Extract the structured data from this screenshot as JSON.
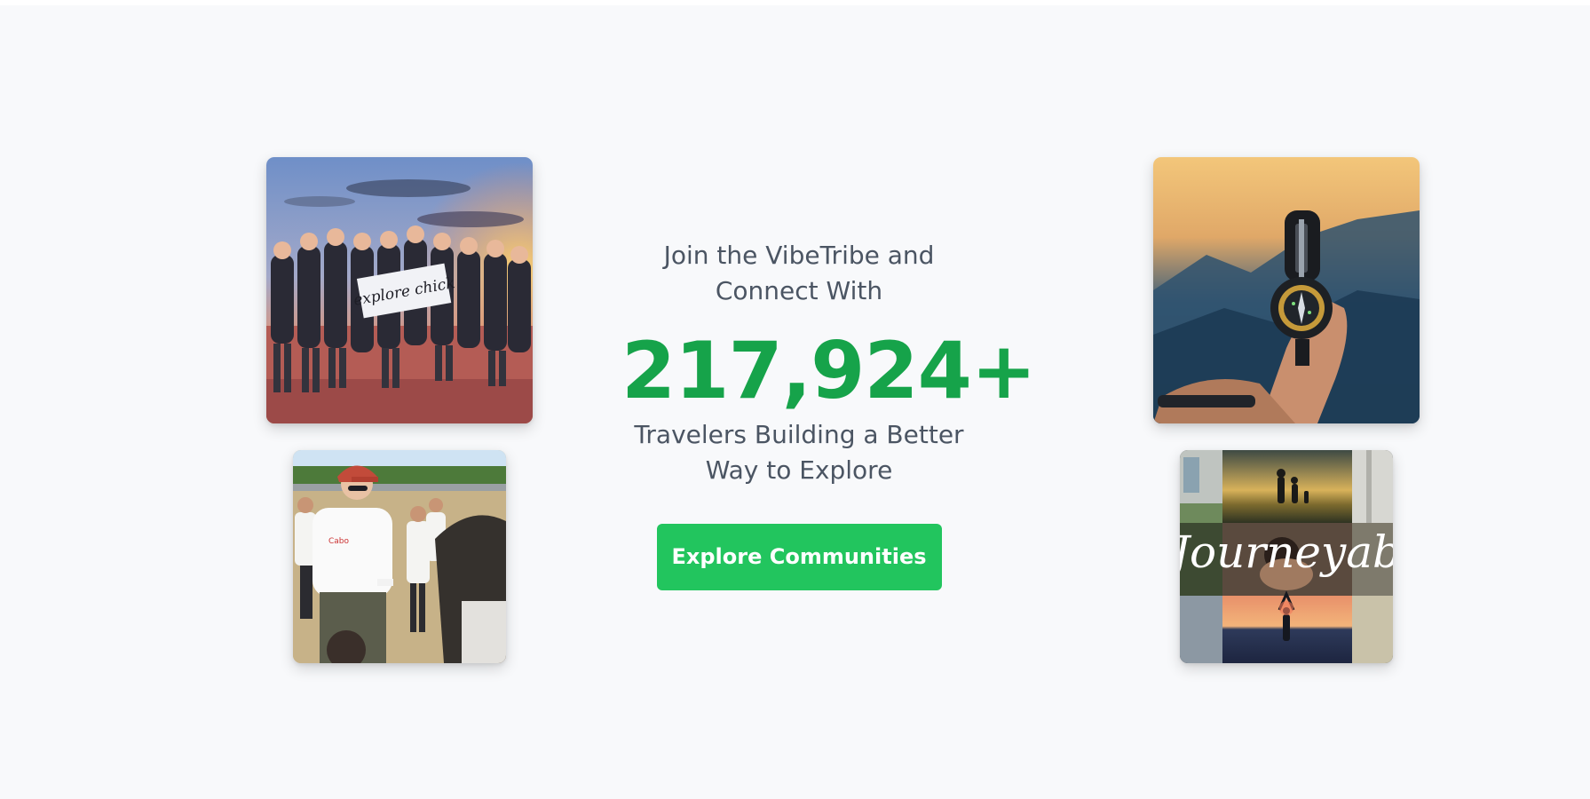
{
  "hero": {
    "lead_line_1": "Join the VibeTribe and",
    "lead_line_2": "Connect With",
    "traveler_count": "217,924+",
    "tail_line_1": "Travelers Building a Better",
    "tail_line_2": "Way to Explore",
    "cta_label": "Explore Communities"
  },
  "photos": {
    "group_photo": {
      "banner_text": "explore chick"
    },
    "journey_collage": {
      "overlay_text": "Journeyab"
    }
  },
  "colors": {
    "accent": "#22c55e",
    "count_text": "#16a34a",
    "body_text": "#4b5563",
    "background": "#f8f9fb"
  }
}
